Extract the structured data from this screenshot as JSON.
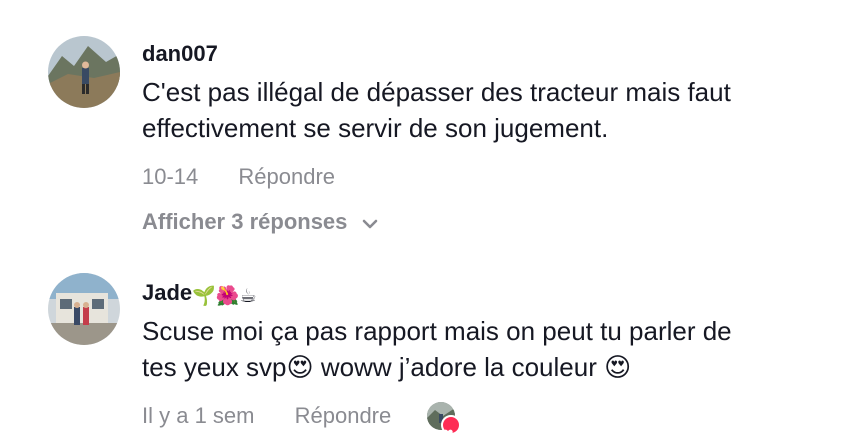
{
  "comments": [
    {
      "username": "dan007",
      "username_emojis": "",
      "text_lines": [
        "C'est pas illégal de dépasser des tracteur mais faut",
        "effectivement se servir de son jugement."
      ],
      "timestamp": "10-14",
      "reply_label": "Répondre",
      "view_replies_label": "Afficher 3 réponses"
    },
    {
      "username": "Jade",
      "username_emojis": "🌱🌺☕",
      "text_lines": [
        "Scuse moi ça pas rapport mais on peut tu parler de",
        "tes yeux svp😍 woww j’adore la couleur 😍"
      ],
      "timestamp": "Il y a 1 sem",
      "reply_label": "Répondre",
      "liked_by_creator": true
    }
  ],
  "icons": {
    "expand": "chevron-down-icon",
    "liked_badge": "heart-icon"
  },
  "colors": {
    "text_primary": "#161823",
    "text_secondary": "#8a8b91",
    "like_accent": "#fe2c55"
  }
}
